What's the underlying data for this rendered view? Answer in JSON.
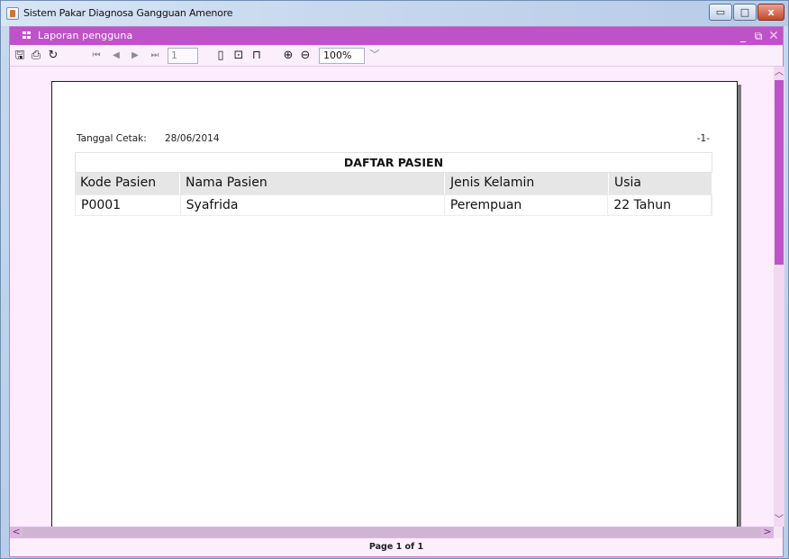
{
  "window": {
    "title": "Sistem Pakar Diagnosa Gangguan Amenore",
    "controls": [
      "minimize",
      "maximize",
      "close"
    ]
  },
  "frame": {
    "title": "Laporan pengguna"
  },
  "toolbar": {
    "page_value": "1",
    "zoom_value": "100%"
  },
  "report": {
    "print_date_label": "Tanggal Cetak:",
    "print_date": "28/06/2014",
    "page_marker": "-1-",
    "table_title": "DAFTAR PASIEN",
    "columns": [
      "Kode Pasien",
      "Nama Pasien",
      "Jenis Kelamin",
      "Usia"
    ],
    "rows": [
      [
        "P0001",
        "Syafrida",
        "Perempuan",
        "22 Tahun"
      ]
    ]
  },
  "status": {
    "page_text": "Page 1 of 1"
  },
  "colors": {
    "frame_accent": "#be53c7",
    "frame_bg": "#f5e6f6"
  }
}
